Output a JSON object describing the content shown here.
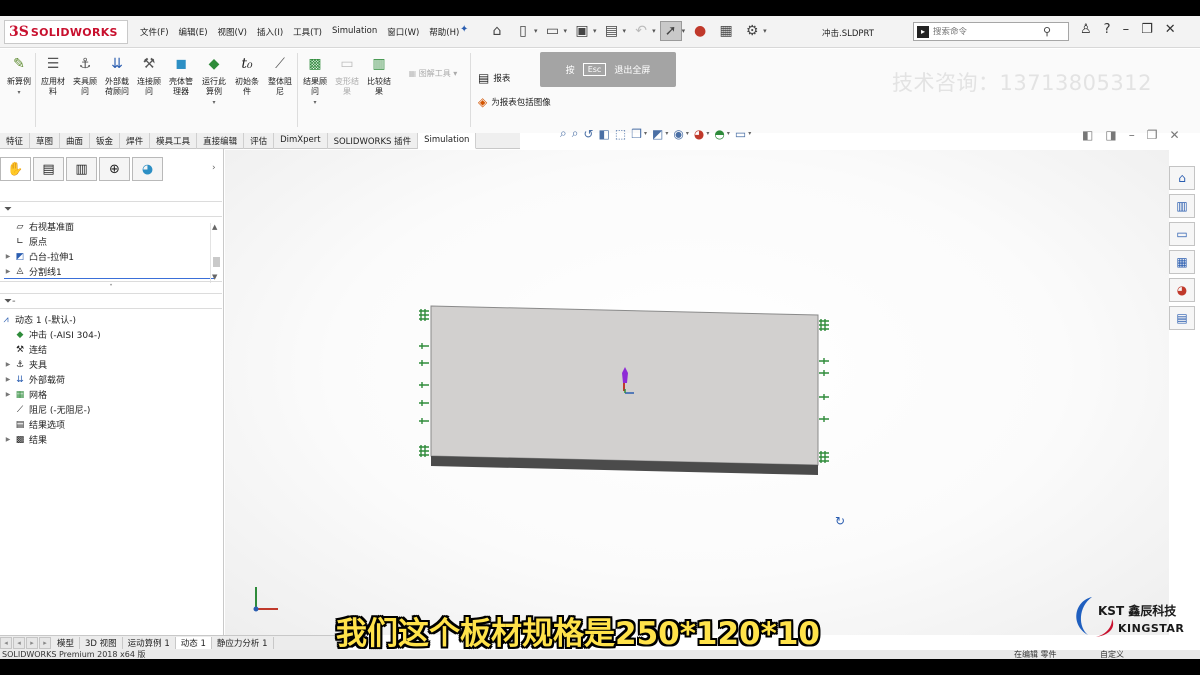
{
  "app": {
    "logo_prefix": "3S",
    "logo_name": "SOLIDWORKS",
    "document_title": "冲击.SLDPRT"
  },
  "menu": [
    "文件(F)",
    "编辑(E)",
    "视图(V)",
    "插入(I)",
    "工具(T)",
    "Simulation",
    "窗口(W)",
    "帮助(H)"
  ],
  "search": {
    "placeholder": "搜索命令"
  },
  "window_controls": {
    "help": "?"
  },
  "ribbon": {
    "new_study": "新算例",
    "apply_material": "应用材\n料",
    "fixtures_advisor": "夹具顾\n问",
    "external_loads_advisor": "外部载\n荷顾问",
    "connections_advisor": "连接顾\n问",
    "shell_manager": "壳体管\n理器",
    "run_study": "运行此\n算例",
    "initial_condition": "初始条\n件",
    "global_damping": "整体阻\n尼",
    "results_advisor": "结果顾\n问",
    "deformed_result": "变形结\n果",
    "compare_results": "比较结\n果",
    "plot_tools": "图解工具",
    "report": "报表",
    "include_image": "为报表包括图像"
  },
  "esc_overlay": {
    "press": "按",
    "key": "Esc",
    "action": "退出全屏"
  },
  "watermark_tel": "技术咨询：13713805312",
  "command_tabs": [
    "特征",
    "草图",
    "曲面",
    "钣金",
    "焊件",
    "模具工具",
    "直接编辑",
    "评估",
    "DimXpert",
    "SOLIDWORKS 插件",
    "Simulation"
  ],
  "active_command_tab": "Simulation",
  "feature_tree": [
    {
      "label": "右视基准面",
      "icon": "plane-icon",
      "expandable": false
    },
    {
      "label": "原点",
      "icon": "origin-icon",
      "expandable": false
    },
    {
      "label": "凸台-拉伸1",
      "icon": "extrude-icon",
      "expandable": true
    },
    {
      "label": "分割线1",
      "icon": "split-line-icon",
      "expandable": true
    }
  ],
  "study_tree": [
    {
      "label": "动态 1 (-默认-)",
      "icon": "dynamic-study-icon",
      "expandable": false,
      "indent": 0
    },
    {
      "label": "冲击 (-AISI 304-)",
      "icon": "part-icon",
      "expandable": false,
      "indent": 1
    },
    {
      "label": "连结",
      "icon": "connections-icon",
      "expandable": false,
      "indent": 1
    },
    {
      "label": "夹具",
      "icon": "fixture-icon",
      "expandable": true,
      "indent": 1
    },
    {
      "label": "外部载荷",
      "icon": "load-icon",
      "expandable": true,
      "indent": 1
    },
    {
      "label": "网格",
      "icon": "mesh-icon",
      "expandable": true,
      "indent": 1
    },
    {
      "label": "阻尼 (-无阻尼-)",
      "icon": "damping-icon",
      "expandable": false,
      "indent": 1
    },
    {
      "label": "结果选项",
      "icon": "result-options-icon",
      "expandable": false,
      "indent": 1
    },
    {
      "label": "结果",
      "icon": "results-icon",
      "expandable": true,
      "indent": 1
    }
  ],
  "bottom_tabs": [
    "模型",
    "3D 视图",
    "运动算例 1",
    "动态 1",
    "静应力分析 1"
  ],
  "active_bottom_tab": "动态 1",
  "status": {
    "left": "SOLIDWORKS Premium 2018 x64 版",
    "editing": "在编辑 零件",
    "custom": "自定义"
  },
  "brand": {
    "top": "KST 鑫辰科技",
    "bottom": "KINGSTAR"
  },
  "subtitle": "我们这个板材规格是250*120*10",
  "colors": {
    "logo_red": "#c8102e",
    "fixture_green": "#2e8b3a",
    "subtitle_yellow": "#ffe24a",
    "plate_face": "#d2d0cf",
    "plate_edge": "#4b4b4b"
  }
}
